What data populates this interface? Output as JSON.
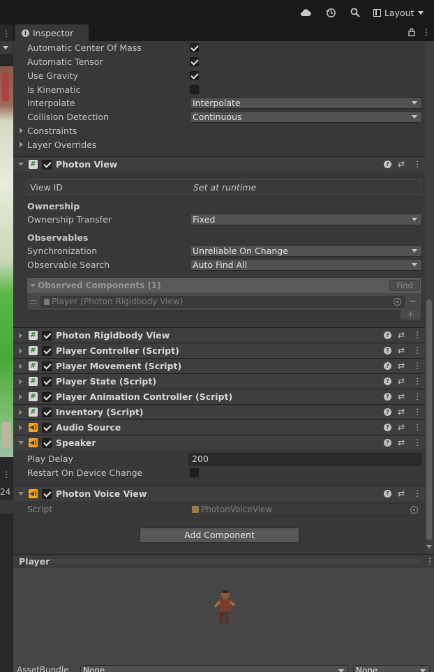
{
  "toolbar": {
    "cloud_icon": "cloud-icon",
    "history_icon": "history-icon",
    "search_icon": "search-icon",
    "layout_label": "Layout"
  },
  "left_panel": {
    "frame_counter": "24"
  },
  "tab": {
    "title": "Inspector"
  },
  "rigidbody_props": [
    {
      "label": "Automatic Center Of Mass",
      "type": "checkbox",
      "checked": true
    },
    {
      "label": "Automatic Tensor",
      "type": "checkbox",
      "checked": true
    },
    {
      "label": "Use Gravity",
      "type": "checkbox",
      "checked": true
    },
    {
      "label": "Is Kinematic",
      "type": "checkbox",
      "checked": false
    },
    {
      "label": "Interpolate",
      "type": "dropdown",
      "value": "Interpolate"
    },
    {
      "label": "Collision Detection",
      "type": "dropdown",
      "value": "Continuous"
    },
    {
      "label": "Constraints",
      "type": "foldout"
    },
    {
      "label": "Layer Overrides",
      "type": "foldout"
    }
  ],
  "photon_view": {
    "name": "Photon View",
    "view_id_label": "View ID",
    "view_id_value": "Set at runtime",
    "ownership_heading": "Ownership",
    "ownership_transfer_label": "Ownership Transfer",
    "ownership_transfer_value": "Fixed",
    "observables_heading": "Observables",
    "sync_label": "Synchronization",
    "sync_value": "Unreliable On Change",
    "search_label": "Observable Search",
    "search_value": "Auto Find All",
    "observed_title": "Observed Components (1)",
    "find_label": "Find",
    "observed_item": "Player (Photon Rigidbody View)",
    "minus": "−",
    "plus": "+"
  },
  "components": [
    {
      "name": "Photon Rigidbody View",
      "icon": "script"
    },
    {
      "name": "Player Controller (Script)",
      "icon": "script"
    },
    {
      "name": "Player Movement (Script)",
      "icon": "script"
    },
    {
      "name": "Player State (Script)",
      "icon": "script"
    },
    {
      "name": "Player Animation Controller (Script)",
      "icon": "script"
    },
    {
      "name": "Inventory (Script)",
      "icon": "script"
    },
    {
      "name": "Audio Source",
      "icon": "audio"
    }
  ],
  "speaker": {
    "name": "Speaker",
    "play_delay_label": "Play Delay",
    "play_delay_value": "200",
    "restart_label": "Restart On Device Change",
    "restart_checked": false
  },
  "photon_voice_view": {
    "name": "Photon Voice View",
    "script_label": "Script",
    "script_value": "PhotonVoiceView"
  },
  "add_component_label": "Add Component",
  "preview": {
    "title": "Player"
  },
  "asset_bundle": {
    "label": "AssetBundle",
    "name_value": "None",
    "variant_value": "None"
  },
  "colors": {
    "background": "#383838",
    "header": "#3e3e3e",
    "accent_script": "#2e7d32",
    "accent_audio": "#f6a623"
  }
}
